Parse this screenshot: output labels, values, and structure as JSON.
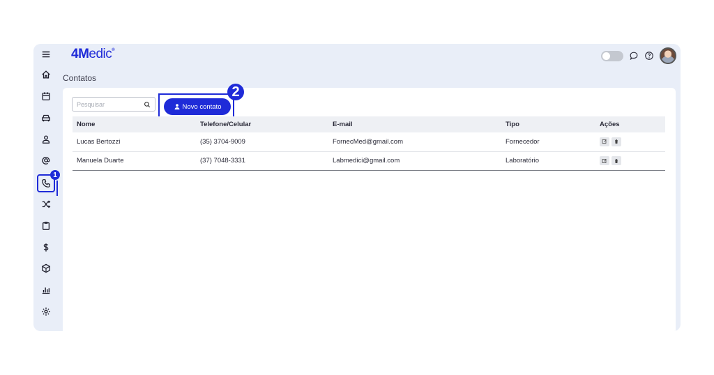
{
  "brand": {
    "logo_bold": "4M",
    "logo_rest": "edic",
    "logo_mark": "®"
  },
  "header": {
    "icons": [
      "toggle-switch",
      "chat-icon",
      "help-icon",
      "user-avatar"
    ]
  },
  "sidebar": {
    "items": [
      {
        "icon": "menu-icon"
      },
      {
        "icon": "home-icon"
      },
      {
        "icon": "calendar-icon"
      },
      {
        "icon": "car-icon"
      },
      {
        "icon": "user-icon"
      },
      {
        "icon": "at-icon"
      },
      {
        "icon": "phone-icon",
        "active": true
      },
      {
        "icon": "shuffle-icon"
      },
      {
        "icon": "clipboard-icon"
      },
      {
        "icon": "dollar-icon"
      },
      {
        "icon": "box-icon"
      },
      {
        "icon": "chart-icon"
      },
      {
        "icon": "settings-icon"
      }
    ],
    "step_badge": "1"
  },
  "page": {
    "title": "Contatos"
  },
  "search": {
    "placeholder": "Pesquisar"
  },
  "new_contact": {
    "label": "Novo contato",
    "step_badge": "2"
  },
  "table": {
    "headers": [
      "Nome",
      "Telefone/Celular",
      "E-mail",
      "Tipo",
      "Ações"
    ],
    "rows": [
      {
        "nome": "Lucas Bertozzi",
        "telefone": "(35) 3704-9009",
        "email": "FornecMed@gmail.com",
        "tipo": "Fornecedor"
      },
      {
        "nome": "Manuela Duarte",
        "telefone": "(37) 7048-3331",
        "email": "Labmedici@gmail.com",
        "tipo": "Laboratório"
      }
    ]
  },
  "colors": {
    "accent": "#1f2bd8",
    "frame_bg": "#e9eef8"
  }
}
